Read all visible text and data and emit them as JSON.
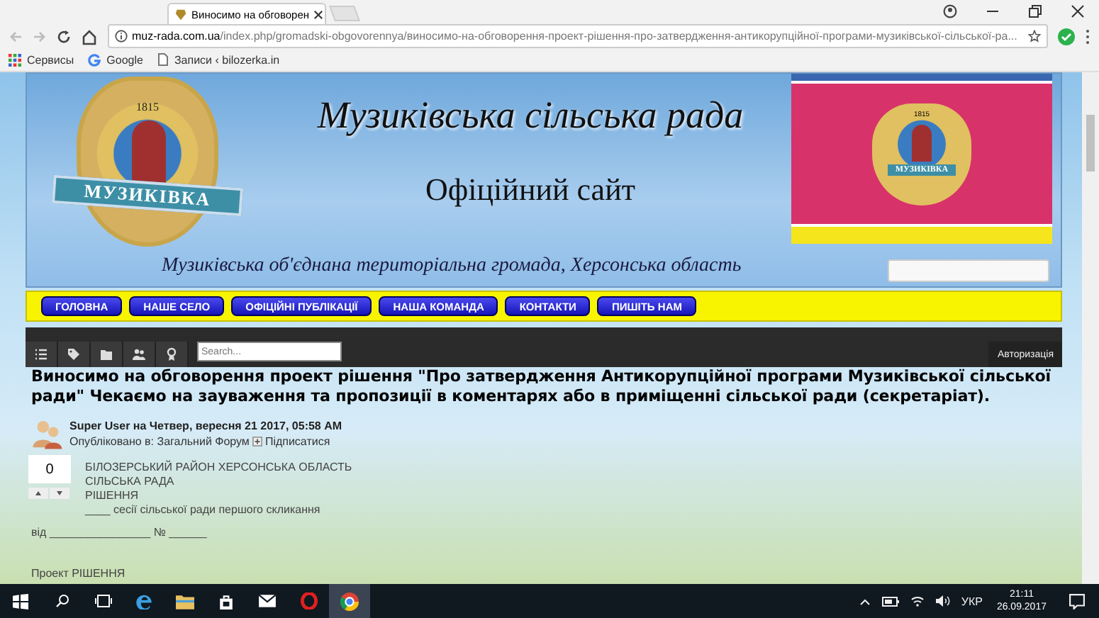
{
  "browser": {
    "tab_title": "Виносимо на обговорен",
    "url_host": "muz-rada.com.ua",
    "url_path": "/index.php/gromadski-obgovorennya/виносимо-на-обговорення-проект-рішення-про-затвердження-антикорупційної-програми-музиківської-сільської-ра...",
    "bookmarks": [
      "Сервисы",
      "Google",
      "Записи ‹ bilozerka.in"
    ]
  },
  "site": {
    "title": "Музиківська сільська рада",
    "subtitle": "Офіційний сайт",
    "tagline": "Музиківська об'єднана територіальна громада, Херсонська область",
    "emblems": [
      {
        "year": "1815",
        "label": "МУЗИКІВКА"
      },
      {
        "year": "1815",
        "label": "МУЗИКІВКА"
      }
    ]
  },
  "nav": [
    {
      "label": "ГОЛОВНА"
    },
    {
      "label": "НАШЕ СЕЛО"
    },
    {
      "label": "ОФІЦІЙНІ ПУБЛІКАЦІЇ"
    },
    {
      "label": "НАША КОМАНДА"
    },
    {
      "label": "КОНТАКТИ"
    },
    {
      "label": "ПИШІТЬ НАМ"
    }
  ],
  "forum": {
    "search_placeholder": "Search...",
    "login": "Авторизація"
  },
  "post": {
    "title": "Виносимо на обговорення проект рішення \"Про затвердження Антикорупційної програми Музиківської сільської ради\" Чекаємо на зауваження та пропозиції в коментарях або в приміщенні сільської ради (секретаріат).",
    "byline": "**Super User** на Четвер, вересня 21 2017, 05:58 AM",
    "published": "Опубліковано в: Загальний Форум",
    "subscribe": "Підписатися",
    "votes": "0",
    "body": [
      "БІЛОЗЕРСЬКИЙ РАЙОН ХЕРСОНСЬКА ОБЛАСТЬ",
      "СІЛЬСЬКА РАДА",
      "РІШЕННЯ",
      "____ сесії сільської ради першого скликання"
    ],
    "date_line": "від ________________ № ______",
    "project": "Проект РІШЕННЯ"
  },
  "taskbar": {
    "lang": "УКР",
    "time": "21:11",
    "date": "26.09.2017"
  }
}
